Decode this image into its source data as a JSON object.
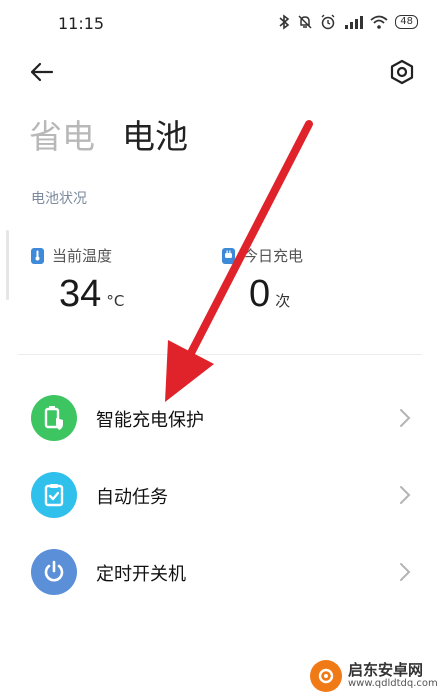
{
  "status_bar": {
    "time": "11:15",
    "battery": "48"
  },
  "header": {
    "tab_power_saving": "省电",
    "tab_battery": "电池"
  },
  "battery_status": {
    "section_label": "电池状况",
    "temperature": {
      "label": "当前温度",
      "value": "34",
      "unit": "°C"
    },
    "charges_today": {
      "label": "今日充电",
      "value": "0",
      "unit": "次"
    }
  },
  "menu": [
    {
      "label": "智能充电保护",
      "icon": "battery-shield-icon",
      "color": "#3cc561"
    },
    {
      "label": "自动任务",
      "icon": "clipboard-check-icon",
      "color": "#2fc0ec"
    },
    {
      "label": "定时开关机",
      "icon": "power-icon",
      "color": "#5b8fd8"
    }
  ],
  "watermark": {
    "title": "启东安卓网",
    "url": "www.qdldtdq.com"
  },
  "colors": {
    "accent_blue": "#3f8ad8",
    "annotation_red": "#e0232a",
    "watermark_orange": "#f07a16"
  }
}
